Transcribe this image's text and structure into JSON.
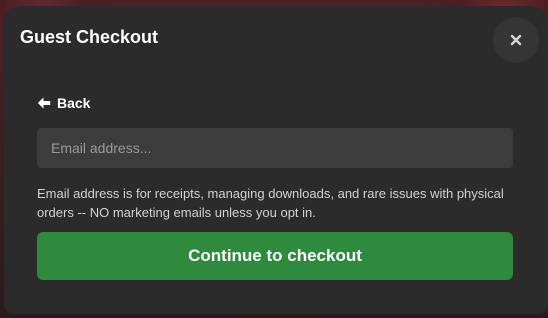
{
  "modal": {
    "title": "Guest Checkout",
    "close_icon": "close-icon",
    "back": {
      "icon": "arrow-left-icon",
      "label": "Back"
    },
    "email": {
      "placeholder": "Email address...",
      "value": ""
    },
    "help_text": "Email address is for receipts, managing downloads, and rare issues with physical orders -- NO marketing emails unless you opt in.",
    "continue_label": "Continue to checkout"
  },
  "colors": {
    "modal_background": "#2b2b2b",
    "input_background": "#3c3c3c",
    "button_green": "#2e8a3c",
    "text_primary": "#ffffff",
    "text_secondary": "#d2d2d2"
  }
}
